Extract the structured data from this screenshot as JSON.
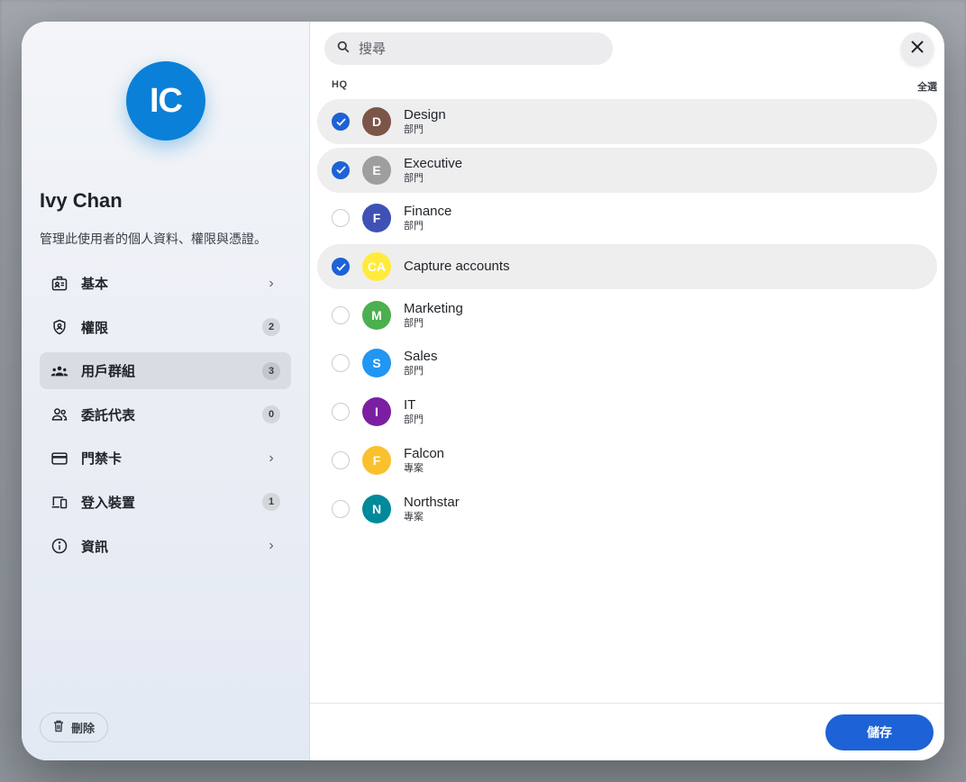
{
  "user": {
    "initials": "IC",
    "avatar_color": "#0a80d8",
    "name": "Ivy Chan",
    "description": "管理此使用者的個人資料、權限與憑證。"
  },
  "nav": {
    "items": [
      {
        "label": "基本",
        "icon": "id-card-icon",
        "count": null,
        "chevron": true,
        "active": false
      },
      {
        "label": "權限",
        "icon": "shield-icon",
        "count": "2",
        "chevron": false,
        "active": false
      },
      {
        "label": "用戶群組",
        "icon": "groups-icon",
        "count": "3",
        "chevron": false,
        "active": true
      },
      {
        "label": "委託代表",
        "icon": "delegate-icon",
        "count": "0",
        "chevron": false,
        "active": false
      },
      {
        "label": "門禁卡",
        "icon": "credit-card-icon",
        "count": null,
        "chevron": true,
        "active": false
      },
      {
        "label": "登入裝置",
        "icon": "devices-icon",
        "count": "1",
        "chevron": false,
        "active": false
      },
      {
        "label": "資訊",
        "icon": "info-icon",
        "count": null,
        "chevron": true,
        "active": false
      }
    ]
  },
  "delete_label": "刪除",
  "search": {
    "placeholder": "搜尋",
    "value": ""
  },
  "section_label": "HQ",
  "select_all_label": "全選",
  "groups": [
    {
      "initials": "D",
      "name": "Design",
      "type": "部門",
      "color": "#7b5547",
      "selected": true
    },
    {
      "initials": "E",
      "name": "Executive",
      "type": "部門",
      "color": "#9e9e9e",
      "selected": true
    },
    {
      "initials": "F",
      "name": "Finance",
      "type": "部門",
      "color": "#3f51b5",
      "selected": false
    },
    {
      "initials": "CA",
      "name": "Capture accounts",
      "type": "",
      "color": "#ffeb3b",
      "selected": true
    },
    {
      "initials": "M",
      "name": "Marketing",
      "type": "部門",
      "color": "#4caf50",
      "selected": false
    },
    {
      "initials": "S",
      "name": "Sales",
      "type": "部門",
      "color": "#2196f3",
      "selected": false
    },
    {
      "initials": "I",
      "name": "IT",
      "type": "部門",
      "color": "#7b1fa2",
      "selected": false
    },
    {
      "initials": "F",
      "name": "Falcon",
      "type": "專案",
      "color": "#fbc02d",
      "selected": false
    },
    {
      "initials": "N",
      "name": "Northstar",
      "type": "專案",
      "color": "#00899b",
      "selected": false
    }
  ],
  "save_label": "儲存",
  "accent_color": "#1d62d6"
}
